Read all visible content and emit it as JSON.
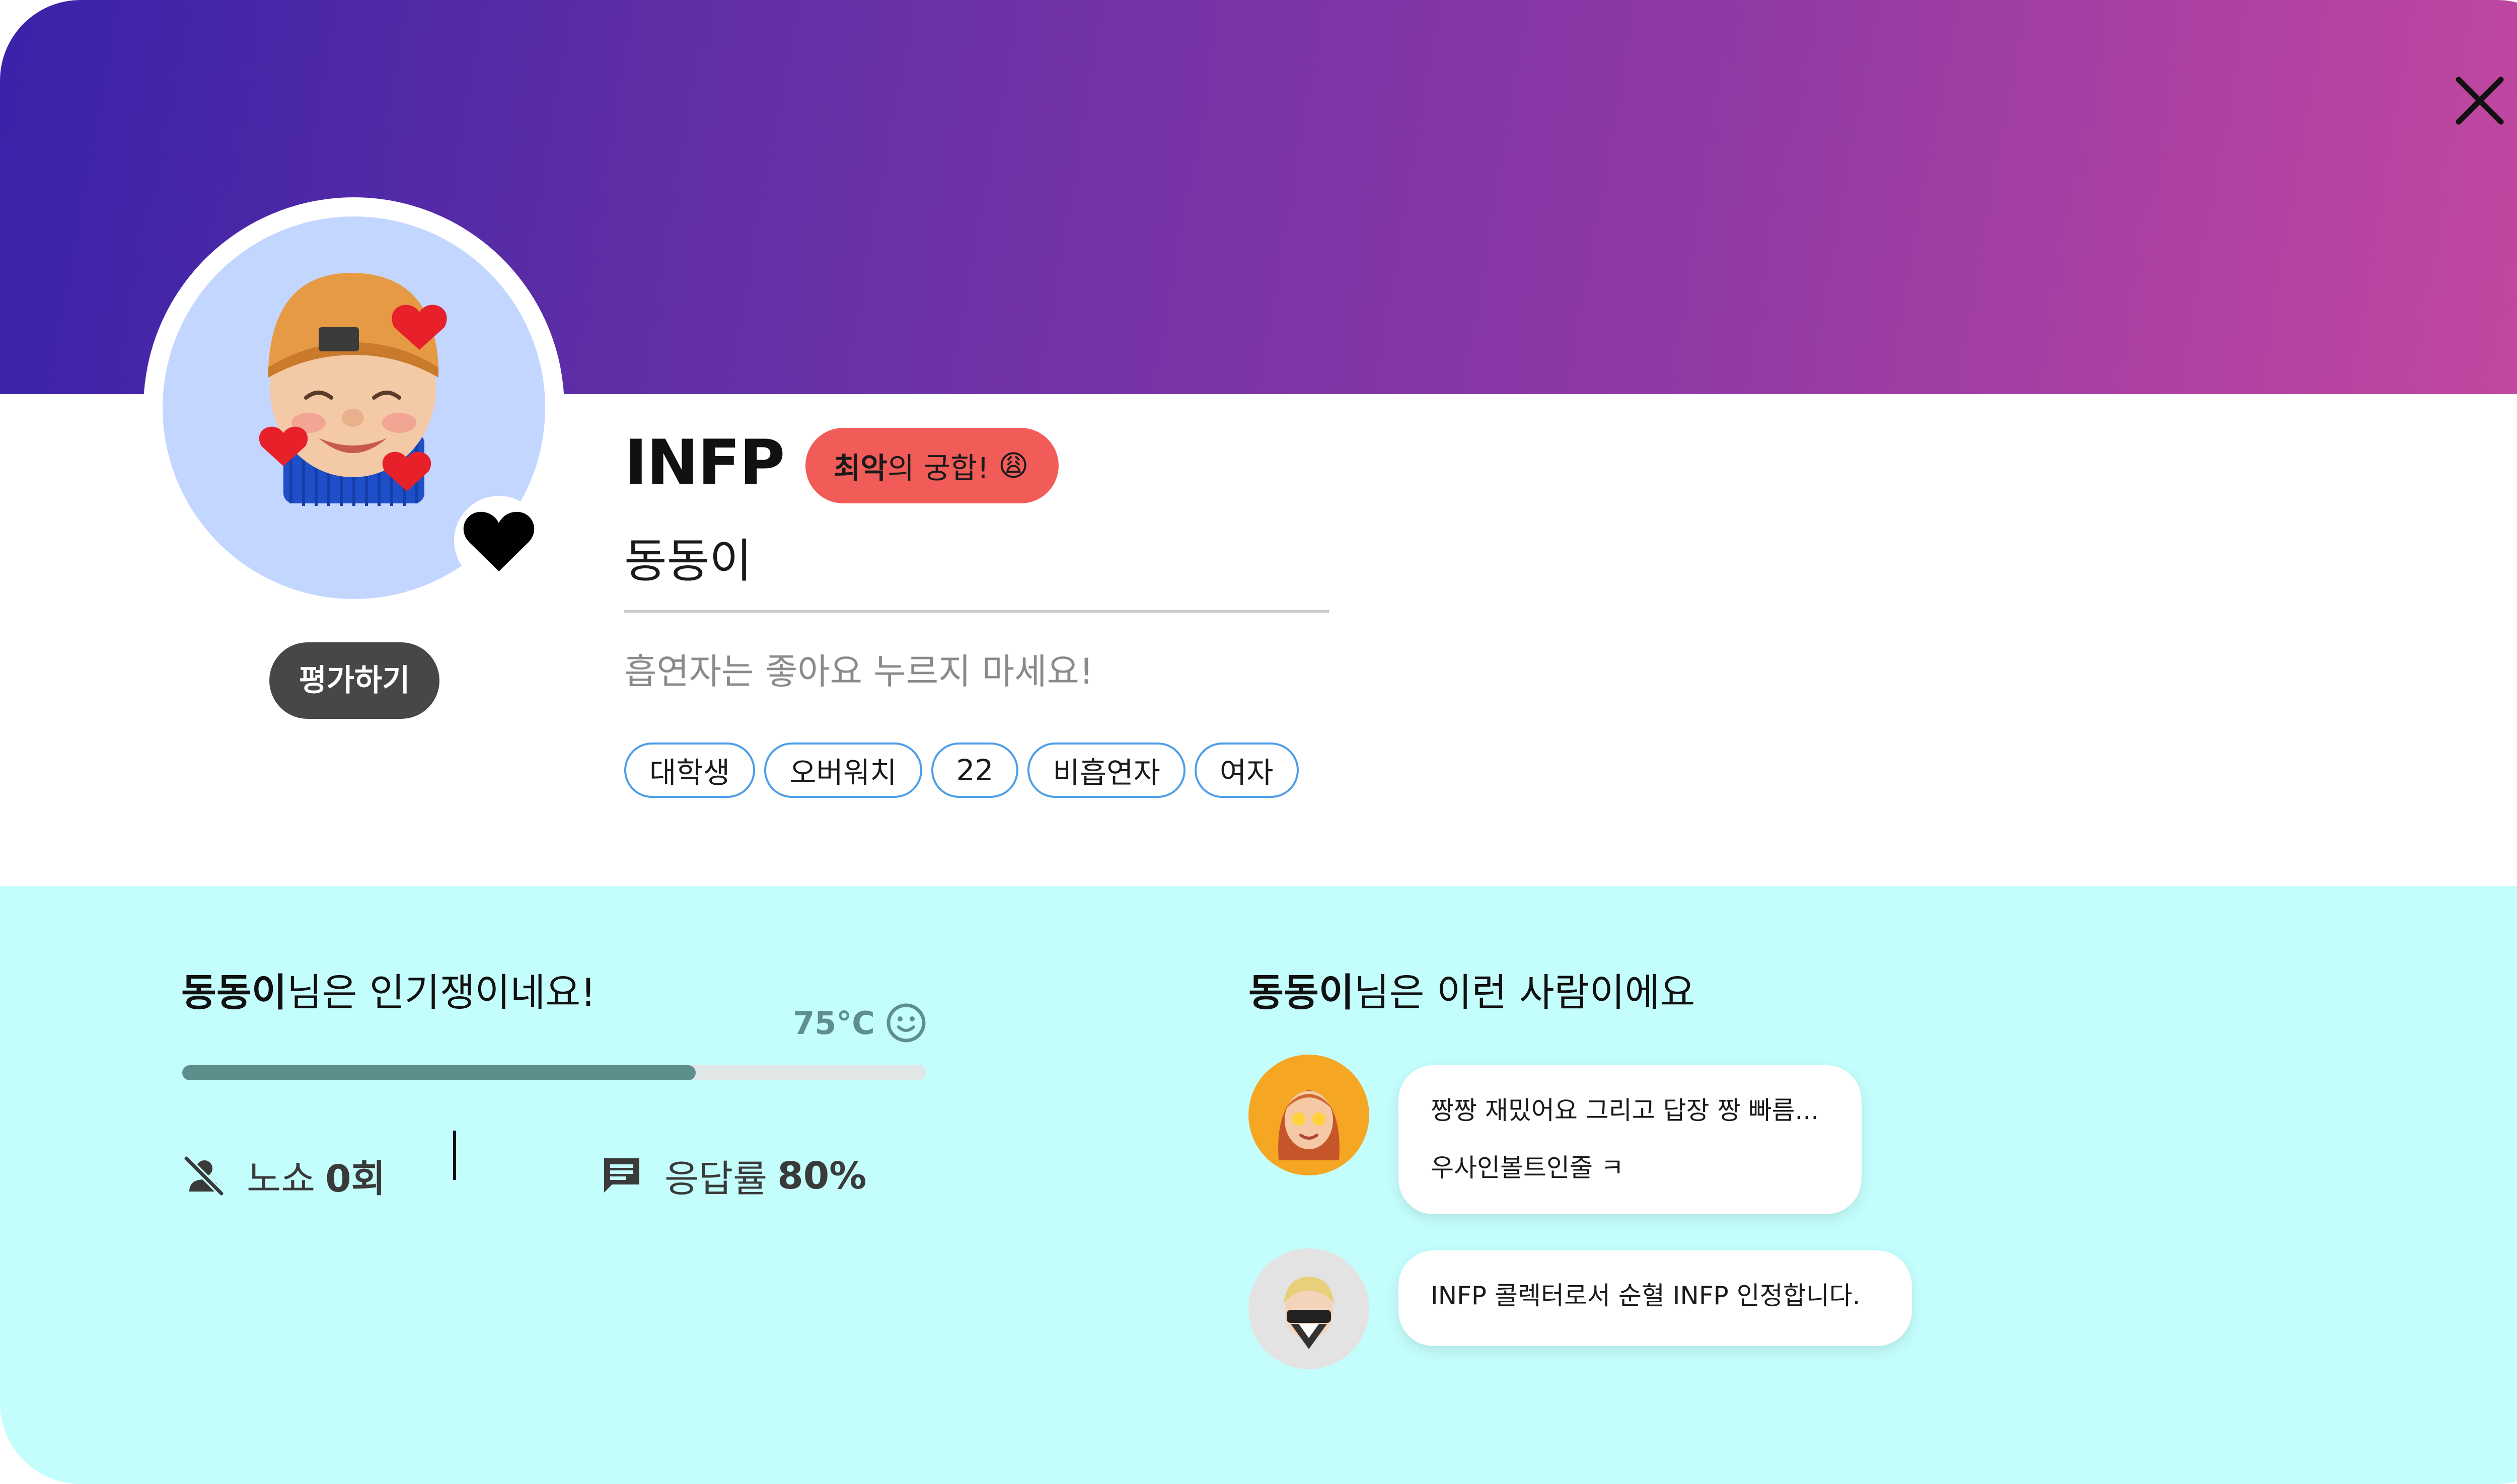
{
  "profile": {
    "mbti": "INFP",
    "compatibility": {
      "strong": "최악",
      "rest": "의 궁합! ",
      "emoji": "😩"
    },
    "nickname": "동동이",
    "bio": "흡연자는 좋아요 누르지 마세요!",
    "tags": [
      "대학생",
      "오버워치",
      "22",
      "비흡연자",
      "여자"
    ],
    "rate_button": "평가하기"
  },
  "popularity": {
    "name": "동동이",
    "suffix": "님은 인기쟁이네요!",
    "temperature": "75°C",
    "progress": 0.69,
    "noshow_label": "노쇼",
    "noshow_value": "0회",
    "response_label": "응답률",
    "response_value": "80%"
  },
  "type_reviews": {
    "name": "동동이",
    "suffix": "님은 이런 사람이에요",
    "reviews": [
      {
        "line1": "짱짱 재밌어요 그리고 답장 짱 빠름...",
        "line2": "우사인볼트인줄 ㅋ"
      },
      {
        "line1": "INFP 콜렉터로서 순혈 INFP 인정합니다."
      }
    ]
  },
  "icons": {
    "close": "close-icon",
    "heart": "heart-icon",
    "smile": "smile-icon",
    "noshow": "person-off-icon",
    "response": "chat-icon"
  },
  "colors": {
    "banner_start": "#3a22a8",
    "banner_end": "#c6489f",
    "compat_badge": "#f25c58",
    "tag_border": "#4d9ee8",
    "bottom_bg": "#c4fefc",
    "progress_fill": "#5c8e8b"
  }
}
